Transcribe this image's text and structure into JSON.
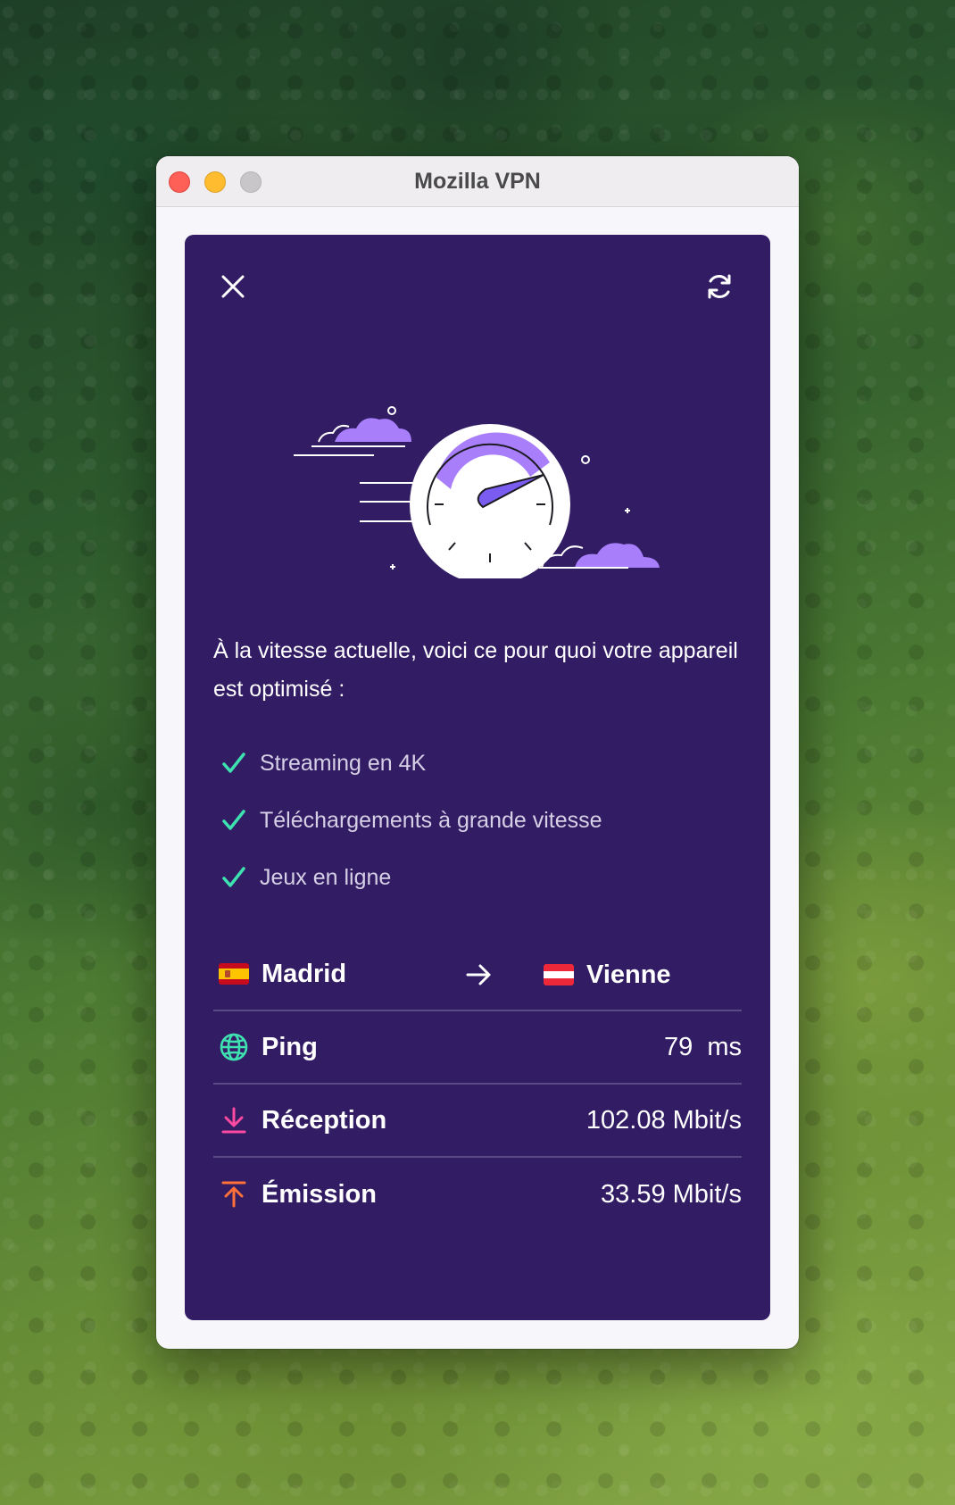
{
  "window": {
    "title": "Mozilla VPN"
  },
  "intro": {
    "text": "À la vitesse actuelle, voici ce pour quoi votre appareil est optimisé :"
  },
  "capabilities": [
    {
      "label": "Streaming en 4K",
      "icon": "checkmark-icon"
    },
    {
      "label": "Téléchargements à grande vitesse",
      "icon": "checkmark-icon"
    },
    {
      "label": "Jeux en ligne",
      "icon": "checkmark-icon"
    }
  ],
  "connection": {
    "from": {
      "city": "Madrid",
      "flag": "spain-flag"
    },
    "to": {
      "city": "Vienne",
      "flag": "austria-flag"
    }
  },
  "stats": {
    "ping": {
      "label": "Ping",
      "value": "79  ms",
      "icon": "globe-icon"
    },
    "download": {
      "label": "Réception",
      "value": "102.08 Mbit/s",
      "icon": "download-arrow-icon"
    },
    "upload": {
      "label": "Émission",
      "value": "33.59 Mbit/s",
      "icon": "upload-arrow-icon"
    }
  },
  "colors": {
    "panel_bg": "#321c64",
    "accent_teal": "#3fe1b0",
    "download_pink": "#ff4aa2",
    "upload_orange": "#ff7139",
    "illustration_purple": "#a97efb"
  }
}
